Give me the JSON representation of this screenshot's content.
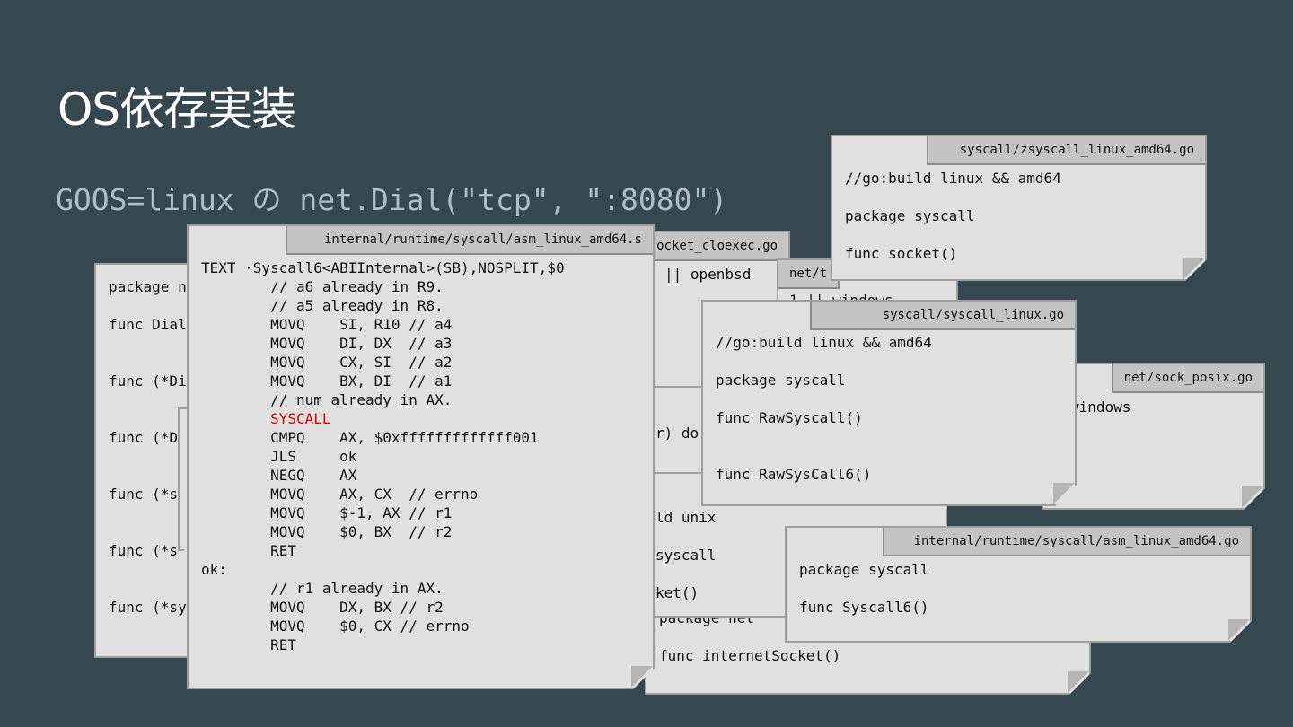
{
  "slide": {
    "title": "OS依存実装",
    "subtitle": "GOOS=linux の net.Dial(\"tcp\", \":8080\")"
  },
  "notes": {
    "dial": {
      "lines": [
        "package n",
        "",
        "func Dial",
        "",
        "",
        "func (*Di",
        "",
        "",
        "func (*D",
        "",
        "",
        "func (*s",
        "",
        "",
        "func (*s",
        "",
        "",
        "func (*sy"
      ]
    },
    "socket_cloexec": {
      "tab": "ocket_cloexec.go",
      "lines": [
        "|| openbsd"
      ]
    },
    "net_tcp": {
      "tab": "net/t",
      "lines": [
        "1 || windows"
      ]
    },
    "net_mid": {
      "lines": [
        "r) do"
      ]
    },
    "unix_syscall": {
      "lines": [
        "ld unix",
        "",
        "syscall",
        "",
        "ket()"
      ]
    },
    "internet_socket": {
      "lines": [
        "package net",
        "",
        "func internetSocket()"
      ]
    },
    "sock_posix": {
      "tab": "net/sock_posix.go",
      "lines": [
        "windows"
      ]
    },
    "zsyscall": {
      "tab": "syscall/zsyscall_linux_amd64.go",
      "lines": [
        "//go:build linux && amd64",
        "",
        "package syscall",
        "",
        "func socket()"
      ]
    },
    "syscall_linux": {
      "tab": "syscall/syscall_linux.go",
      "lines": [
        "//go:build linux && amd64",
        "",
        "package syscall",
        "",
        "func RawSyscall()",
        "",
        "",
        "func RawSysCall6()"
      ]
    },
    "asm_small": {
      "tab": "internal/runtime/syscall/asm_linux_amd64.go",
      "lines": [
        "package syscall",
        "",
        "func Syscall6()"
      ]
    },
    "asm_big": {
      "tab": "internal/runtime/syscall/asm_linux_amd64.s",
      "lines": [
        "TEXT ·Syscall6<ABIInternal>(SB),NOSPLIT,$0",
        "\t// a6 already in R9.",
        "\t// a5 already in R8.",
        "\tMOVQ\tSI, R10 // a4",
        "\tMOVQ\tDI, DX  // a3",
        "\tMOVQ\tCX, SI  // a2",
        "\tMOVQ\tBX, DI  // a1",
        "\t// num already in AX.",
        "\tSYSCALL",
        "\tCMPQ\tAX, $0xfffffffffffff001",
        "\tJLS\tok",
        "\tNEGQ\tAX",
        "\tMOVQ\tAX, CX  // errno",
        "\tMOVQ\t$-1, AX // r1",
        "\tMOVQ\t$0, BX  // r2",
        "\tRET",
        "ok:",
        "\t// r1 already in AX.",
        "\tMOVQ\tDX, BX // r2",
        "\tMOVQ\t$0, CX // errno",
        "\tRET"
      ],
      "highlight_line": 8,
      "highlight_color": "#d50000"
    }
  }
}
